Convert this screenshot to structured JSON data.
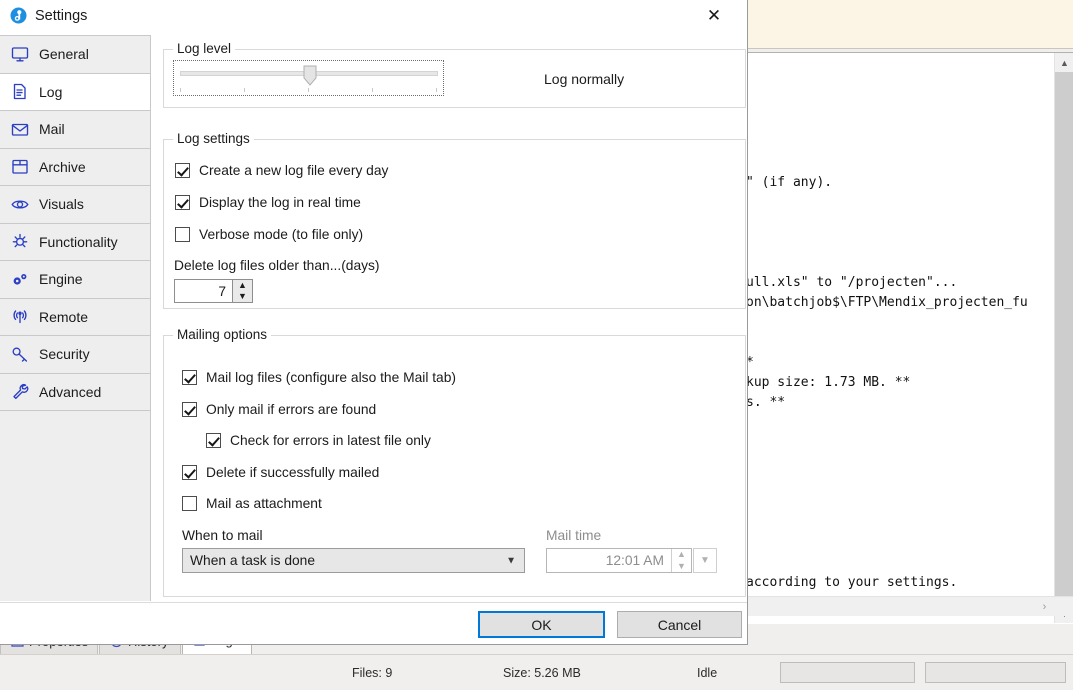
{
  "dialog": {
    "title": "Settings",
    "title_icon": "settings-disc-icon",
    "close_label": "✕"
  },
  "sidebar": {
    "items": [
      {
        "label": "General",
        "icon": "monitor-icon",
        "active": false
      },
      {
        "label": "Log",
        "icon": "document-icon",
        "active": true
      },
      {
        "label": "Mail",
        "icon": "envelope-icon",
        "active": false
      },
      {
        "label": "Archive",
        "icon": "archive-box-icon",
        "active": false
      },
      {
        "label": "Visuals",
        "icon": "eye-icon",
        "active": false
      },
      {
        "label": "Functionality",
        "icon": "bug-icon",
        "active": false
      },
      {
        "label": "Engine",
        "icon": "gears-icon",
        "active": false
      },
      {
        "label": "Remote",
        "icon": "antenna-icon",
        "active": false
      },
      {
        "label": "Security",
        "icon": "key-icon",
        "active": false
      },
      {
        "label": "Advanced",
        "icon": "wrench-icon",
        "active": false
      }
    ]
  },
  "log_level": {
    "legend": "Log level",
    "slider_value": 2,
    "slider_min": 0,
    "slider_max": 4,
    "value_text": "Log normally"
  },
  "log_settings": {
    "legend": "Log settings",
    "checkboxes": [
      {
        "label": "Create a new log file every day",
        "checked": true
      },
      {
        "label": "Display the log in real time",
        "checked": true
      },
      {
        "label": "Verbose mode (to file only)",
        "checked": false
      }
    ],
    "delete_label": "Delete log files older than...(days)",
    "delete_value": "7"
  },
  "mailing_options": {
    "legend": "Mailing options",
    "checkboxes": [
      {
        "label": "Mail log files (configure also the Mail tab)",
        "checked": true,
        "indent": 0
      },
      {
        "label": "Only mail if errors are found",
        "checked": true,
        "indent": 0
      },
      {
        "label": "Check for errors in latest file only",
        "checked": true,
        "indent": 1
      },
      {
        "label": "Delete if successfully mailed",
        "checked": true,
        "indent": 0
      },
      {
        "label": "Mail as attachment",
        "checked": false,
        "indent": 0
      }
    ],
    "when_to_mail_label": "When to mail",
    "when_to_mail_value": "When a task is done",
    "mail_time_label": "Mail time",
    "mail_time_value": "12:01 AM",
    "mail_time_disabled": true
  },
  "footer": {
    "ok_label": "OK",
    "cancel_label": "Cancel"
  },
  "background": {
    "log_lines": [
      "",
      "",
      "",
      "",
      "",
      "",
      "\" (if any).",
      "",
      "",
      "",
      "",
      "ull.xls\" to \"/projecten\"...",
      "on\\batchjob$\\FTP\\Mendix_projecten_fu",
      "",
      "",
      "*",
      "kup size: 1.73 MB. **",
      "s. **",
      "",
      "",
      "",
      "",
      "",
      "",
      "",
      "",
      "according to your settings."
    ],
    "tabs": [
      {
        "label": "Properties",
        "icon": "properties-icon",
        "selected": false
      },
      {
        "label": "History",
        "icon": "history-icon",
        "selected": false
      },
      {
        "label": "Log",
        "icon": "log-icon",
        "selected": true
      }
    ],
    "status": {
      "files": "Files: 9",
      "size": "Size: 5.26 MB",
      "state": "Idle"
    }
  },
  "colors": {
    "accent": "#0078d7",
    "icon_blue": "#2b3fc4",
    "cream_panel": "#fcf4e4",
    "sidebar_bg": "#eeeeee"
  }
}
